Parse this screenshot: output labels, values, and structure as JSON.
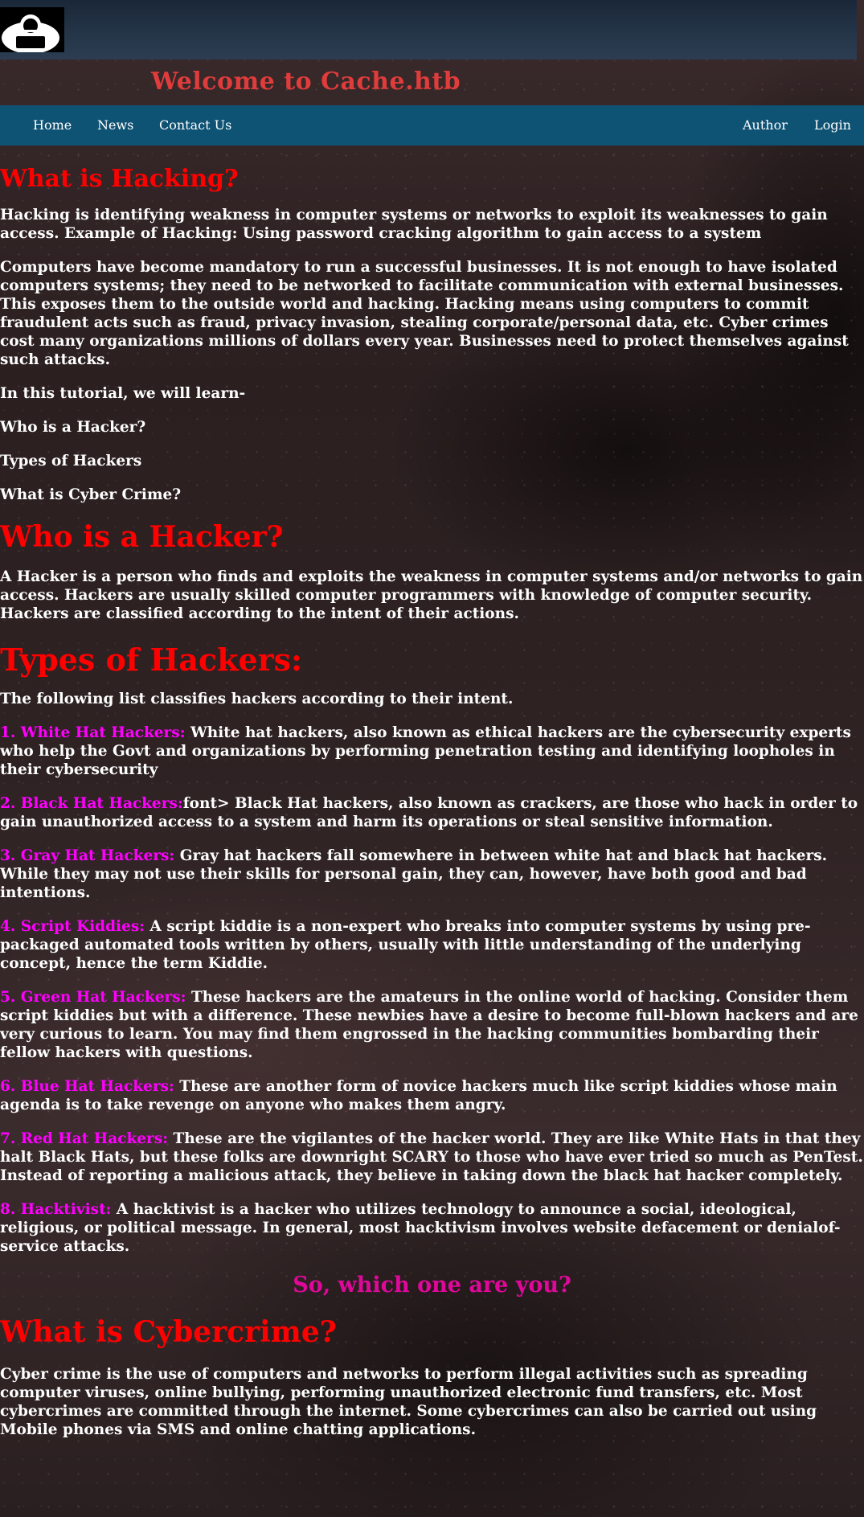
{
  "header": {
    "logo_icon": "hacker-avatar-icon",
    "title": "Welcome to Cache.htb"
  },
  "nav": {
    "left": [
      "Home",
      "News",
      "Contact Us"
    ],
    "right": [
      "Author",
      "Login"
    ]
  },
  "sections": {
    "hacking": {
      "heading": "What is Hacking?",
      "p1": "Hacking is identifying weakness in computer systems or networks to exploit its weaknesses to gain access. Example of Hacking: Using password cracking algorithm to gain access to a system",
      "p2": "Computers have become mandatory to run a successful businesses. It is not enough to have isolated computers systems; they need to be networked to facilitate communication with external businesses. This exposes them to the outside world and hacking. Hacking means using computers to commit fraudulent acts such as fraud, privacy invasion, stealing corporate/personal data, etc. Cyber crimes cost many organizations millions of dollars every year. Businesses need to protect themselves against such attacks.",
      "p3": "In this tutorial, we will learn-",
      "toc": [
        "Who is a Hacker?",
        "Types of Hackers",
        "What is Cyber Crime?"
      ]
    },
    "who": {
      "heading": "Who is a Hacker?",
      "p1": "A Hacker is a person who finds and exploits the weakness in computer systems and/or networks to gain access. Hackers are usually skilled computer programmers with knowledge of computer security. Hackers are classified according to the intent of their actions."
    },
    "types": {
      "heading": "Types of Hackers:",
      "intro": "The following list classifies hackers according to their intent.",
      "items": [
        {
          "label": "1. White Hat Hackers:",
          "text": " White hat hackers, also known as ethical hackers are the cybersecurity experts who help the Govt and organizations by performing penetration testing and identifying loopholes in their cybersecurity"
        },
        {
          "label": "2. Black Hat Hackers:",
          "text": "font> Black Hat hackers, also known as crackers, are those who hack in order to gain unauthorized access to a system and harm its operations or steal sensitive information."
        },
        {
          "label": "3. Gray Hat Hackers:",
          "text": " Gray hat hackers fall somewhere in between white hat and black hat hackers. While they may not use their skills for personal gain, they can, however, have both good and bad intentions."
        },
        {
          "label": "4. Script Kiddies:",
          "text": " A script kiddie is a non-expert who breaks into computer systems by using pre-packaged automated tools written by others, usually with little understanding of the underlying concept, hence the term Kiddie."
        },
        {
          "label": "5. Green Hat Hackers:",
          "text": " These hackers are the amateurs in the online world of hacking. Consider them script kiddies but with a difference. These newbies have a desire to become full-blown hackers and are very curious to learn. You may find them engrossed in the hacking communities bombarding their fellow hackers with questions."
        },
        {
          "label": "6. Blue Hat Hackers:",
          "text": " These are another form of novice hackers much like script kiddies whose main agenda is to take revenge on anyone who makes them angry."
        },
        {
          "label": "7. Red Hat Hackers:",
          "text": " These are the vigilantes of the hacker world. They are like White Hats in that they halt Black Hats, but these folks are downright SCARY to those who have ever tried so much as PenTest. Instead of reporting a malicious attack, they believe in taking down the black hat hacker completely."
        },
        {
          "label": "8. Hacktivist:",
          "text": " A hacktivist is a hacker who utilizes technology to announce a social, ideological, religious, or political message. In general, most hacktivism involves website defacement or denialof-service attacks."
        }
      ],
      "closing": "So, which one are you?"
    },
    "cybercrime": {
      "heading": "What is Cybercrime?",
      "p1": "Cyber crime is the use of computers and networks to perform illegal activities such as spreading computer viruses, online bullying, performing unauthorized electronic fund transfers, etc. Most cybercrimes are committed through the internet. Some cybercrimes can also be carried out using Mobile phones via SMS and online chatting applications."
    }
  },
  "colors": {
    "heading": "#ff0000",
    "title": "#e03c3c",
    "nav_bg": "#0e5274",
    "hacker_type": "#ff00ff",
    "closing": "#e0089a"
  }
}
